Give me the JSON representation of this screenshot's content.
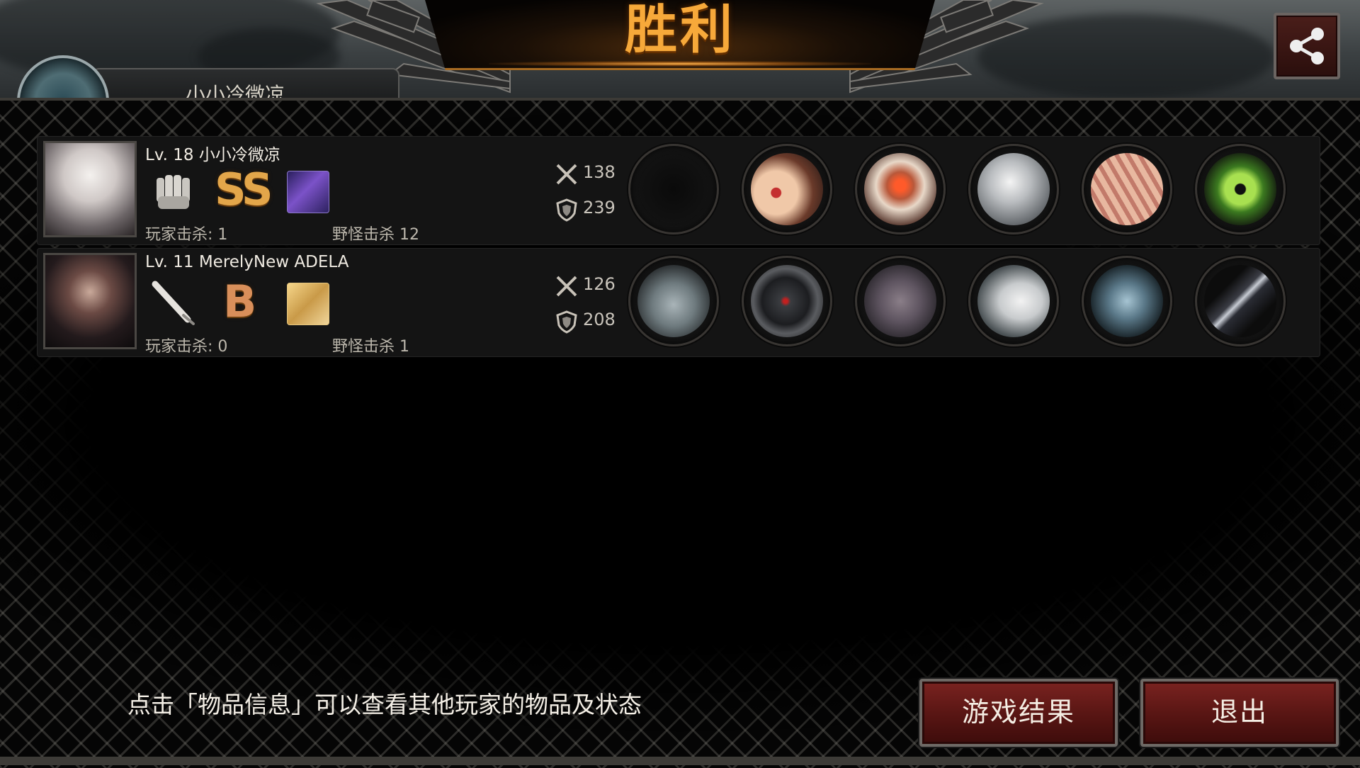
{
  "header": {
    "title": "胜利",
    "player_name_partial": "小小冷微凉",
    "share_icon": "share-icon"
  },
  "players": [
    {
      "level_name": "Lv. 18 小小冷微凉",
      "weapon_icon": "fist-icon",
      "grade": "SS",
      "skill_icon": "purple-skill-icon",
      "player_kills": "玩家击杀: 1",
      "monster_kills": "野怪击杀 12",
      "attack": "138",
      "defense": "239",
      "items": [
        "empty-slot",
        "winged-circlet-item",
        "red-armor-item",
        "silver-disc-item",
        "bandaged-gauntlet-item",
        "green-eye-amulet-item"
      ]
    },
    {
      "level_name": "Lv. 11 MerelyNew ADELA",
      "weapon_icon": "baseball-bat-icon",
      "grade": "B",
      "skill_icon": "gold-block-skill-icon",
      "player_kills": "玩家击杀: 0",
      "monster_kills": "野怪击杀 1",
      "attack": "126",
      "defense": "208",
      "items": [
        "statue-weapon-item",
        "gas-mask-helmet-item",
        "stone-armor-item",
        "white-sleeve-item",
        "steel-boots-item",
        "black-flag-item"
      ]
    }
  ],
  "footer": {
    "hint": "点击「物品信息」可以查看其他玩家的物品及状态",
    "result_button": "游戏结果",
    "exit_button": "退出"
  },
  "colors": {
    "title": "#f7a93a",
    "grade": "#e3a64a",
    "button_bg": "#571513"
  }
}
